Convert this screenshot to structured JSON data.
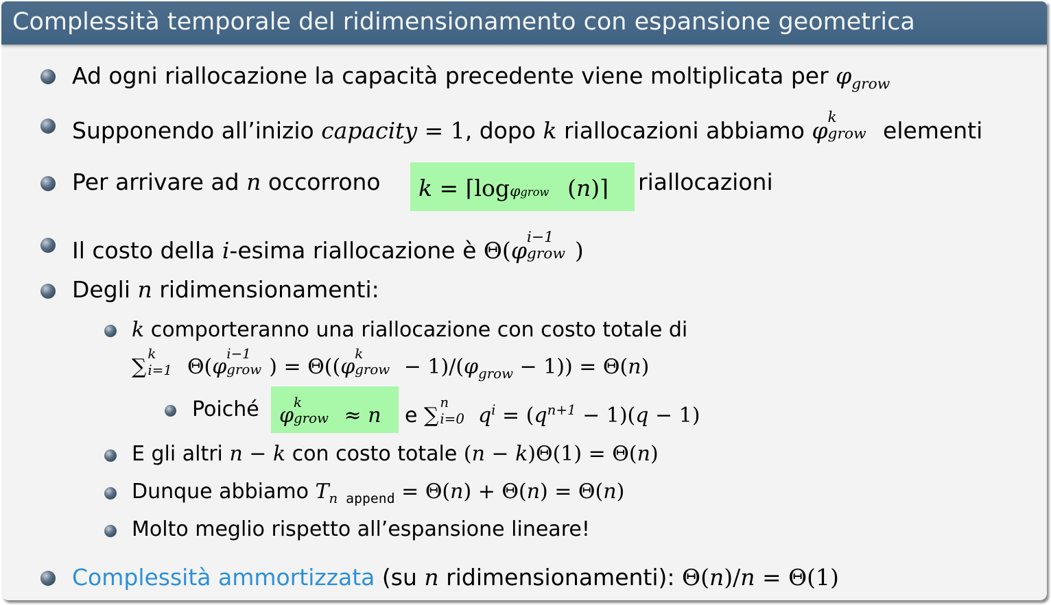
{
  "slide": {
    "title": "Complessità temporale del ridimensionamento con espansione geometrica"
  },
  "items": {
    "b1": {
      "text": "Ad ogni riallocazione la capacità precedente viene moltiplicata per ",
      "math": "φ",
      "math_sub": "grow"
    },
    "b2": {
      "t1": "Supponendo all’inizio ",
      "m1": "capacity",
      "m1b": " = 1",
      "t2": ", dopo ",
      "m2": "k",
      "t3": " riallocazioni abbiamo ",
      "m3": "φ",
      "m3_sup": "k",
      "m3_sub": "grow",
      "t4": " elementi"
    },
    "b3": {
      "t1": "Per arrivare ad ",
      "m1": "n",
      "t2": " occorrono ",
      "hl_a": "k",
      "hl_b": " = ⌈log",
      "hl_sub_phi": "φ",
      "hl_sub_grow": "grow",
      "hl_c": "(",
      "hl_n": "n",
      "hl_d": ")⌉",
      "t3": " riallocazioni"
    },
    "b4": {
      "t1": "Il costo della ",
      "m1": "i",
      "t2": "-esima riallocazione è ",
      "m2a": "Θ(",
      "m2phi": "φ",
      "m2_sup": "i−1",
      "m2_sub": "grow",
      "m2b": ")"
    },
    "b5": {
      "t1": "Degli ",
      "m1": "n",
      "t2": " ridimensionamenti:"
    },
    "s1": {
      "m1": "k",
      "t1": " comporteranno una riallocazione con costo totale di",
      "sum": "∑",
      "sum_sup": "k",
      "sum_sub": "i=1",
      "f1": " Θ(",
      "f1phi": "φ",
      "f1_sup": "i−1",
      "f1_sub": "grow",
      "f2": ") = Θ((",
      "f2phi": "φ",
      "f2_sup": "k",
      "f2_sub": "grow",
      "f3": " − 1)/(",
      "f3phi": "φ",
      "f3_sub": "grow",
      "f4": " − 1)) = Θ(",
      "f4n": "n",
      "f5": ")"
    },
    "ss1": {
      "t1": "Poiché ",
      "hl_phi": "φ",
      "hl_sup": "k",
      "hl_sub": "grow",
      "hl_b": " ≈ ",
      "hl_n": "n",
      "t2": " e ",
      "sum": "∑",
      "sum_sup": "n",
      "sum_sub": "i=0",
      "q1": " q",
      "q1_sup": "i",
      "f1": " = (",
      "q2": "q",
      "q2_sup": "n+1",
      "f2": " − 1)(",
      "q3": "q",
      "f3": " − 1)"
    },
    "s2": {
      "t1": "E gli altri ",
      "m1": "n",
      "m1b": " − ",
      "m1c": "k",
      "t2": " con costo totale ",
      "f1": "(",
      "f1n": "n",
      "f1b": " − ",
      "f1k": "k",
      "f2": ")Θ(1) = Θ(",
      "f2n": "n",
      "f3": ")"
    },
    "s3": {
      "t1": "Dunque abbiamo ",
      "T": "T",
      "T_sub_n": "n",
      "T_sub_app": " append",
      "f1": " = Θ(",
      "f1n": "n",
      "f2": ") + Θ(",
      "f2n": "n",
      "f3": ") = Θ(",
      "f3n": "n",
      "f4": ")"
    },
    "s4": {
      "text": "Molto meglio rispetto all’espansione lineare!"
    },
    "b6": {
      "link": "Complessità ammortizzata",
      "t1": " (su ",
      "m1": "n",
      "t2": " ridimensionamenti): ",
      "f1": "Θ(",
      "f1n": "n",
      "f2": ")/",
      "f2n": "n",
      "f3": " = Θ(1)"
    }
  },
  "colors": {
    "title_bar": "#456685",
    "background": "#f3f3f3",
    "highlight": "#a9f8a9",
    "link": "#2d90d6"
  }
}
